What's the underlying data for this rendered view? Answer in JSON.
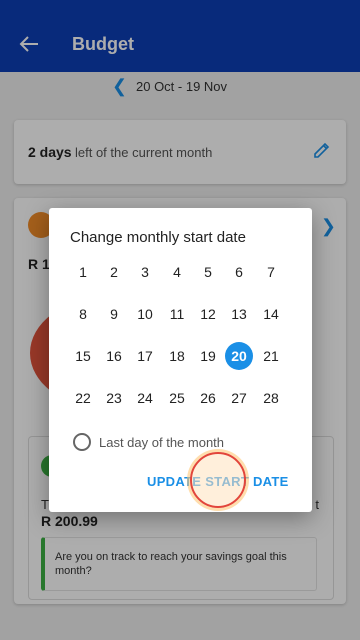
{
  "appbar": {
    "title": "Budget",
    "back_icon": "arrow-left-icon"
  },
  "range": {
    "label": "20 Oct - 19 Nov"
  },
  "days_card": {
    "count": "2 days",
    "text": "left of the current month",
    "edit_icon": "pencil-icon"
  },
  "budget_card": {
    "amount_partial": "R 1",
    "inner": {
      "partial_left": "T",
      "partial_right": "t",
      "amount": "R 200.99",
      "callout": "Are you on track to reach your savings goal this month?"
    }
  },
  "dialog": {
    "title": "Change monthly start date",
    "days": [
      "1",
      "2",
      "3",
      "4",
      "5",
      "6",
      "7",
      "8",
      "9",
      "10",
      "11",
      "12",
      "13",
      "14",
      "15",
      "16",
      "17",
      "18",
      "19",
      "20",
      "21",
      "22",
      "23",
      "24",
      "25",
      "26",
      "27",
      "28"
    ],
    "selected": "20",
    "radio_label": "Last day of the month",
    "button_label": "UPDATE START DATE"
  },
  "colors": {
    "appbar": "#0c3fb6",
    "accent": "#1a8fe6",
    "green": "#3cb043",
    "orange": "#f28c28"
  }
}
